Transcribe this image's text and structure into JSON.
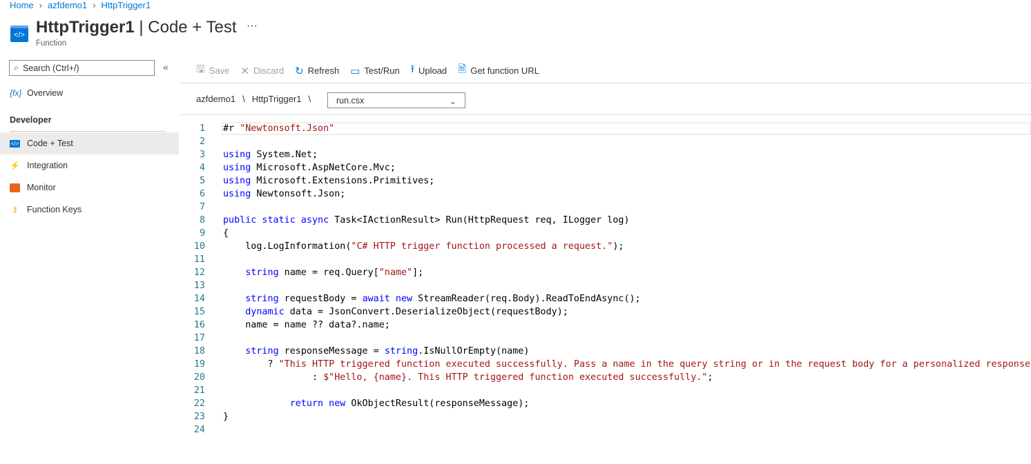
{
  "breadcrumb": [
    "Home",
    "azfdemo1",
    "HttpTrigger1"
  ],
  "header": {
    "title_main": "HttpTrigger1",
    "title_rest": " | Code + Test",
    "subtitle": "Function",
    "more": "···"
  },
  "sidebar": {
    "search_placeholder": "Search (Ctrl+/)",
    "collapse": "«",
    "overview": "Overview",
    "section": "Developer",
    "items": [
      {
        "label": "Code + Test"
      },
      {
        "label": "Integration"
      },
      {
        "label": "Monitor"
      },
      {
        "label": "Function Keys"
      }
    ]
  },
  "toolbar": {
    "save": "Save",
    "discard": "Discard",
    "refresh": "Refresh",
    "testrun": "Test/Run",
    "upload": "Upload",
    "geturl": "Get function URL"
  },
  "path": {
    "app": "azfdemo1",
    "sep": "\\",
    "func": "HttpTrigger1",
    "file": "run.csx"
  },
  "code": [
    [
      [
        "#r ",
        "pl"
      ],
      [
        "\"Newtonsoft.Json\"",
        "str"
      ]
    ],
    [],
    [
      [
        "using",
        "kw"
      ],
      [
        " System.Net;",
        "pl"
      ]
    ],
    [
      [
        "using",
        "kw"
      ],
      [
        " Microsoft.AspNetCore.Mvc;",
        "pl"
      ]
    ],
    [
      [
        "using",
        "kw"
      ],
      [
        " Microsoft.Extensions.Primitives;",
        "pl"
      ]
    ],
    [
      [
        "using",
        "kw"
      ],
      [
        " Newtonsoft.Json;",
        "pl"
      ]
    ],
    [],
    [
      [
        "public static async",
        "kw"
      ],
      [
        " Task<IActionResult> Run(HttpRequest req, ILogger log)",
        "pl"
      ]
    ],
    [
      [
        "{",
        "pl"
      ]
    ],
    [
      [
        "    log.LogInformation(",
        "pl"
      ],
      [
        "\"C# HTTP trigger function processed a request.\"",
        "str"
      ],
      [
        ");",
        "pl"
      ]
    ],
    [],
    [
      [
        "    ",
        "pl"
      ],
      [
        "string",
        "kw"
      ],
      [
        " name = req.Query[",
        "pl"
      ],
      [
        "\"name\"",
        "str"
      ],
      [
        "];",
        "pl"
      ]
    ],
    [],
    [
      [
        "    ",
        "pl"
      ],
      [
        "string",
        "kw"
      ],
      [
        " requestBody = ",
        "pl"
      ],
      [
        "await new",
        "kw"
      ],
      [
        " StreamReader(req.Body).ReadToEndAsync();",
        "pl"
      ]
    ],
    [
      [
        "    ",
        "pl"
      ],
      [
        "dynamic",
        "kw"
      ],
      [
        " data = JsonConvert.DeserializeObject(requestBody);",
        "pl"
      ]
    ],
    [
      [
        "    name = name ?? data?.name;",
        "pl"
      ]
    ],
    [],
    [
      [
        "    ",
        "pl"
      ],
      [
        "string",
        "kw"
      ],
      [
        " responseMessage = ",
        "pl"
      ],
      [
        "string",
        "kw"
      ],
      [
        ".IsNullOrEmpty(name)",
        "pl"
      ]
    ],
    [
      [
        "        ? ",
        "pl"
      ],
      [
        "\"This HTTP triggered function executed successfully. Pass a name in the query string or in the request body for a personalized response.\"",
        "str"
      ]
    ],
    [
      [
        "                : ",
        "pl"
      ],
      [
        "$\"Hello, {name}. This HTTP triggered function executed successfully.\"",
        "str"
      ],
      [
        ";",
        "pl"
      ]
    ],
    [],
    [
      [
        "            ",
        "pl"
      ],
      [
        "return new",
        "kw"
      ],
      [
        " OkObjectResult(responseMessage);",
        "pl"
      ]
    ],
    [
      [
        "}",
        "pl"
      ]
    ],
    []
  ]
}
